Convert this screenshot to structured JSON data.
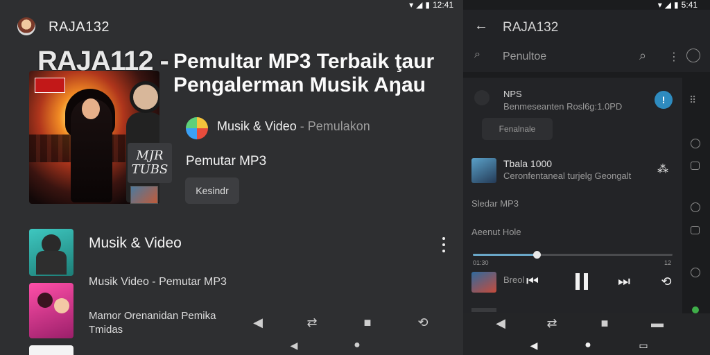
{
  "left": {
    "status_time": "12:41",
    "app_title": "RAJA132",
    "brand_text": "RAJA112 -",
    "headline_line1": "Pemultar MP3 Terbaik ţaur",
    "headline_line2": "Pengalerman Musik Aŋau",
    "overlay_card_text": "MJR TUBS",
    "category_text": "Musik & Video",
    "category_suffix": "- Pemulakon",
    "app_name": "Pemutar MP3",
    "action_button": "Kesindr",
    "list": [
      {
        "title": "Musik & Video",
        "thumb": "teal"
      },
      {
        "title": "Musik Video - Pemutar MP3",
        "thumb": "pink"
      },
      {
        "title_line1": "Mamor Orenanidan Pemika",
        "title_line2": "Tmidas",
        "thumb": "white"
      }
    ],
    "bottom_icons": [
      "back-arrow-icon",
      "shuffle-icon",
      "square-icon",
      "repeat-icon"
    ],
    "system_nav": [
      "back-triangle-icon",
      "home-circle-icon"
    ]
  },
  "right": {
    "status_time": "5:41",
    "title": "RAJA132",
    "search_placeholder": "Penultoe",
    "card": {
      "title": "NPS",
      "subtitle": "Benmeseanten Rosl6g:1.0PD",
      "button": "Fenalnale"
    },
    "track": {
      "title": "Tbala 1000",
      "subtitle": "Ceronfentaneal turjelg Geongalt"
    },
    "section1": "Sledar MP3",
    "section2": "Aeenut Hole",
    "progress": 0.32,
    "time_left": "01:30",
    "time_right": "12",
    "mini_label": "Breol",
    "controls": [
      "skip-previous-icon",
      "pause-icon",
      "skip-next-icon",
      "repeat-icon"
    ],
    "bottom_icons": [
      "back-arrow-icon",
      "shuffle-icon",
      "square-icon",
      "repeat-icon"
    ],
    "system_nav": [
      "back-triangle-icon",
      "home-circle-icon",
      "recents-square-icon"
    ]
  }
}
